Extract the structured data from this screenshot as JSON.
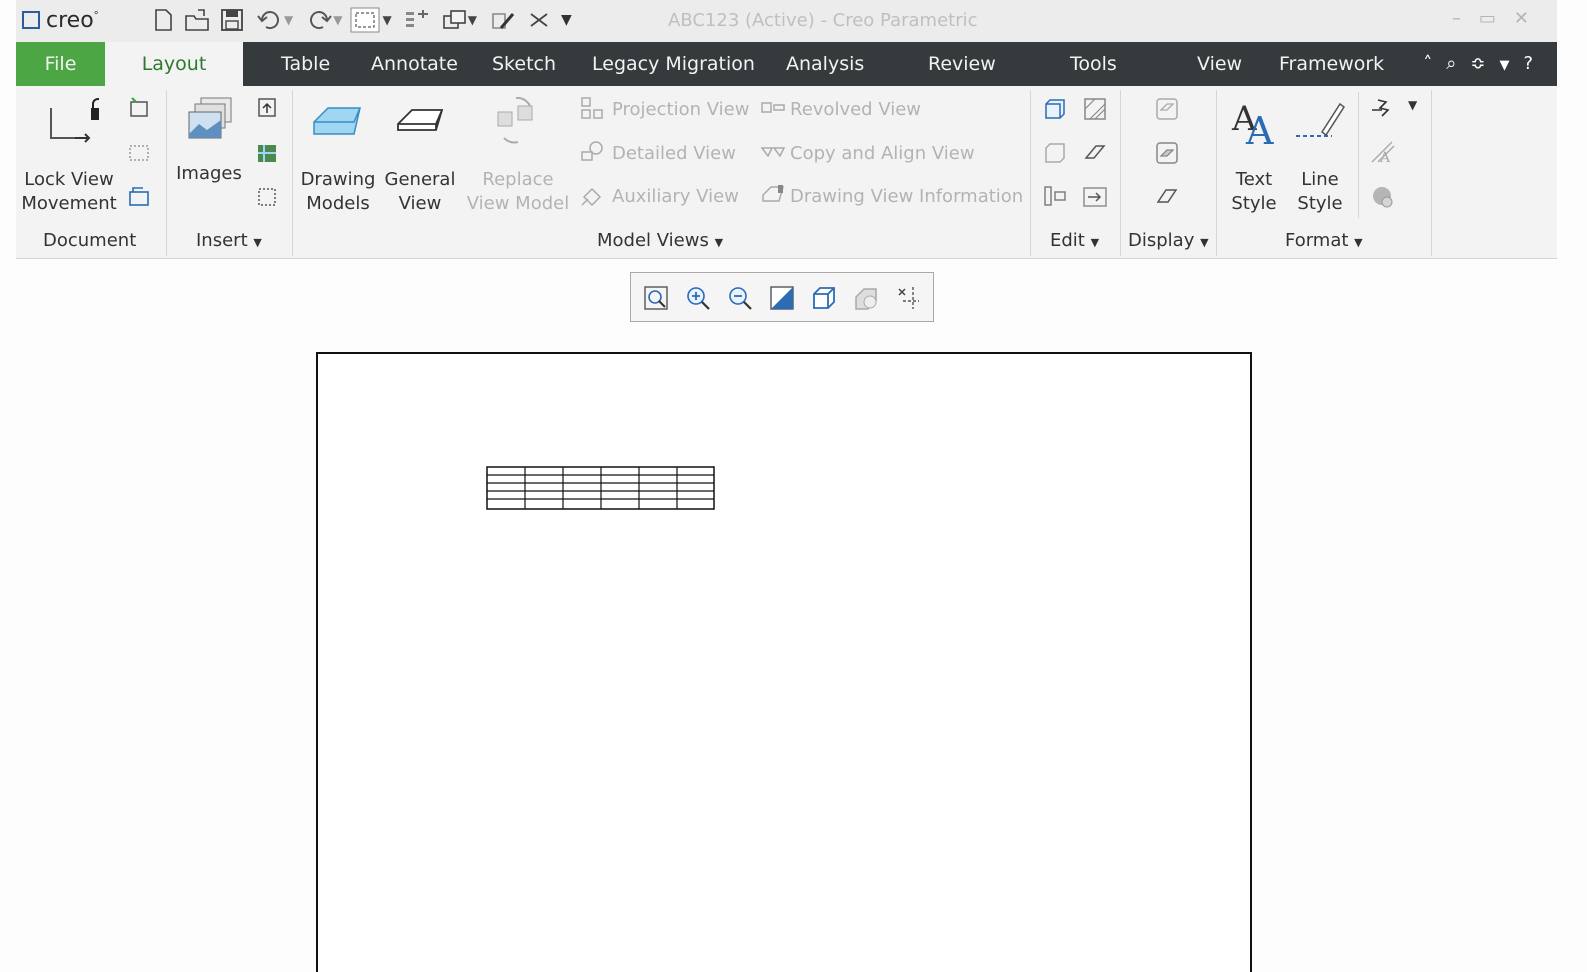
{
  "title_bar": {
    "logo": "creo",
    "title": "ABC123 (Active) - Creo Parametric",
    "controls": [
      "minimize-icon",
      "maximize-icon",
      "close-icon"
    ]
  },
  "tabs": [
    {
      "label": "File"
    },
    {
      "label": "Layout"
    },
    {
      "label": "Table"
    },
    {
      "label": "Annotate"
    },
    {
      "label": "Sketch"
    },
    {
      "label": "Legacy Migration"
    },
    {
      "label": "Analysis"
    },
    {
      "label": "Review"
    },
    {
      "label": "Tools"
    },
    {
      "label": "View"
    },
    {
      "label": "Framework"
    }
  ],
  "groups": {
    "document": {
      "label": "Document",
      "lock_view": "Lock View",
      "movement": "Movement"
    },
    "insert": {
      "label": "Insert",
      "images": "Images"
    },
    "model_views": {
      "label": "Model Views",
      "drawing_models_1": "Drawing",
      "drawing_models_2": "Models",
      "general_view_1": "General",
      "general_view_2": "View",
      "replace_1": "Replace",
      "replace_2": "View Model",
      "projection_view": "Projection View",
      "detailed_view": "Detailed View",
      "auxiliary_view": "Auxiliary View",
      "revolved_view": "Revolved View",
      "copy_align_view": "Copy and Align View",
      "drawing_view_info": "Drawing View Information"
    },
    "edit": {
      "label": "Edit"
    },
    "display": {
      "label": "Display"
    },
    "format": {
      "label": "Format",
      "text_style_1": "Text",
      "text_style_2": "Style",
      "line_style_1": "Line",
      "line_style_2": "Style"
    }
  },
  "colors": {
    "file_tab": "#4ca644",
    "tab_bar": "#353a3d",
    "active_tab_text": "#2d7a2d",
    "icon_blue": "#2b6cb5"
  }
}
